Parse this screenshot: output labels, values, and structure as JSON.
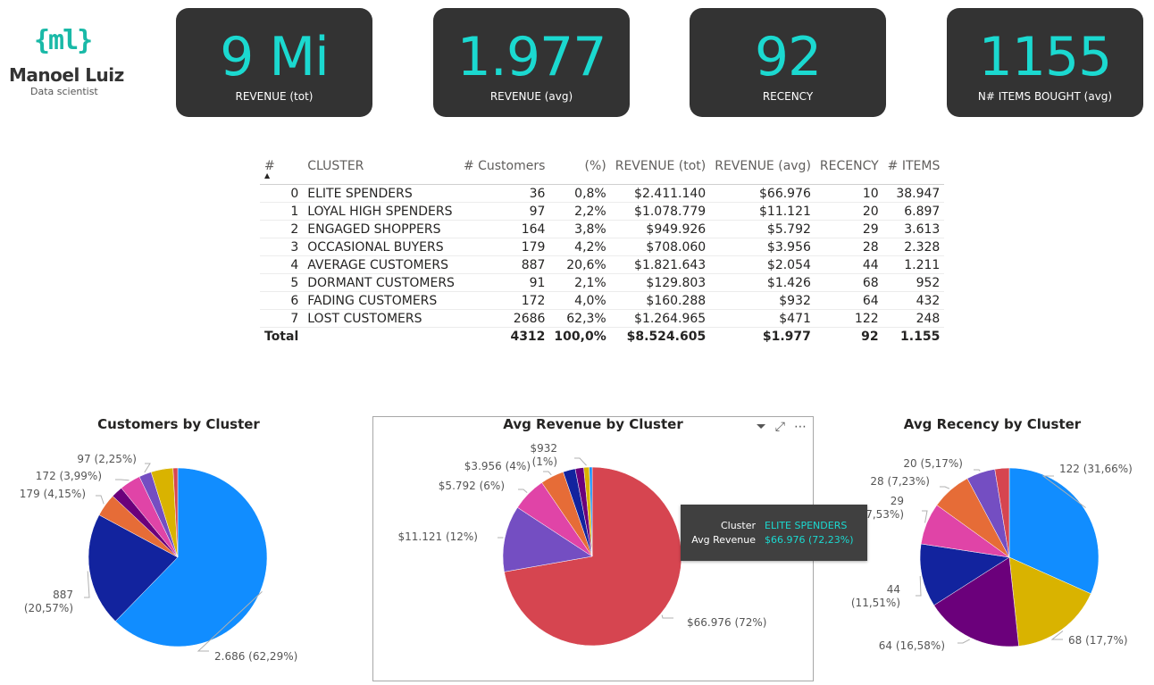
{
  "logo": {
    "mark": "{ml}",
    "name": "Manoel Luiz",
    "role": "Data scientist"
  },
  "kpis": [
    {
      "value": "9 Mi",
      "label": "REVENUE (tot)"
    },
    {
      "value": "1.977",
      "label": "REVENUE (avg)"
    },
    {
      "value": "92",
      "label": "RECENCY"
    },
    {
      "value": "1155",
      "label": "N# ITEMS BOUGHT (avg)"
    }
  ],
  "table": {
    "headers": [
      "#",
      "CLUSTER",
      "# Customers",
      "(%)",
      "REVENUE (tot)",
      "REVENUE (avg)",
      "RECENCY",
      "# ITEMS"
    ],
    "rows": [
      [
        "0",
        "ELITE SPENDERS",
        "36",
        "0,8%",
        "$2.411.140",
        "$66.976",
        "10",
        "38.947"
      ],
      [
        "1",
        "LOYAL HIGH SPENDERS",
        "97",
        "2,2%",
        "$1.078.779",
        "$11.121",
        "20",
        "6.897"
      ],
      [
        "2",
        "ENGAGED SHOPPERS",
        "164",
        "3,8%",
        "$949.926",
        "$5.792",
        "29",
        "3.613"
      ],
      [
        "3",
        "OCCASIONAL BUYERS",
        "179",
        "4,2%",
        "$708.060",
        "$3.956",
        "28",
        "2.328"
      ],
      [
        "4",
        "AVERAGE CUSTOMERS",
        "887",
        "20,6%",
        "$1.821.643",
        "$2.054",
        "44",
        "1.211"
      ],
      [
        "5",
        "DORMANT CUSTOMERS",
        "91",
        "2,1%",
        "$129.803",
        "$1.426",
        "68",
        "952"
      ],
      [
        "6",
        "FADING CUSTOMERS",
        "172",
        "4,0%",
        "$160.288",
        "$932",
        "64",
        "432"
      ],
      [
        "7",
        "LOST CUSTOMERS",
        "2686",
        "62,3%",
        "$1.264.965",
        "$471",
        "122",
        "248"
      ]
    ],
    "total": [
      "Total",
      "",
      "4312",
      "100,0%",
      "$8.524.605",
      "$1.977",
      "92",
      "1.155"
    ]
  },
  "colors": {
    "cluster_colors": [
      "#d64550",
      "#744ec2",
      "#e044a7",
      "#e66c37",
      "#12239e",
      "#6b007b",
      "#d9b300",
      "#118dff"
    ],
    "kpi_value": "#1bd9d0",
    "card_bg": "#333333"
  },
  "icons": {
    "filter": "filter-icon",
    "focus": "focus-mode-icon",
    "more": "more-options-icon",
    "sort": "sort-ascending-icon"
  },
  "tooltip": {
    "k1": "Cluster",
    "v1": "ELITE SPENDERS",
    "k2": "Avg Revenue",
    "v2": "$66.976 (72,23%)"
  },
  "chart_data": [
    {
      "type": "pie",
      "title": "Customers by Cluster",
      "categories": [
        "ELITE SPENDERS",
        "LOYAL HIGH SPENDERS",
        "ENGAGED SHOPPERS",
        "OCCASIONAL BUYERS",
        "AVERAGE CUSTOMERS",
        "DORMANT CUSTOMERS",
        "FADING CUSTOMERS",
        "LOST CUSTOMERS"
      ],
      "values": [
        36,
        97,
        164,
        179,
        887,
        91,
        172,
        2686
      ],
      "order": [
        7,
        4,
        3,
        5,
        2,
        1,
        6,
        0
      ],
      "data_labels": [
        {
          "index": 7,
          "text": "2.686 (62,29%)"
        },
        {
          "index": 4,
          "text": "887",
          "text2": "(20,57%)"
        },
        {
          "index": 3,
          "text": "179 (4,15%)"
        },
        {
          "index": 2,
          "text": "172 (3,99%)"
        },
        {
          "index": 1,
          "text": "97 (2,25%)"
        }
      ]
    },
    {
      "type": "pie",
      "title": "Avg Revenue by Cluster",
      "categories": [
        "ELITE SPENDERS",
        "LOYAL HIGH SPENDERS",
        "ENGAGED SHOPPERS",
        "OCCASIONAL BUYERS",
        "AVERAGE CUSTOMERS",
        "DORMANT CUSTOMERS",
        "FADING CUSTOMERS",
        "LOST CUSTOMERS"
      ],
      "values": [
        66976,
        11121,
        5792,
        3956,
        2054,
        1426,
        932,
        471
      ],
      "order": [
        0,
        1,
        2,
        3,
        4,
        5,
        6,
        7
      ],
      "data_labels": [
        {
          "index": 0,
          "text": "$66.976 (72%)"
        },
        {
          "index": 1,
          "text": "$11.121 (12%)"
        },
        {
          "index": 2,
          "text": "$5.792 (6%)"
        },
        {
          "index": 3,
          "text": "$3.956 (4%)"
        },
        {
          "index": 6,
          "text": "$932",
          "text2": "(1%)"
        }
      ]
    },
    {
      "type": "pie",
      "title": "Avg Recency by Cluster",
      "categories": [
        "ELITE SPENDERS",
        "LOYAL HIGH SPENDERS",
        "ENGAGED SHOPPERS",
        "OCCASIONAL BUYERS",
        "AVERAGE CUSTOMERS",
        "DORMANT CUSTOMERS",
        "FADING CUSTOMERS",
        "LOST CUSTOMERS"
      ],
      "values": [
        10,
        20,
        29,
        28,
        44,
        68,
        64,
        122
      ],
      "order": [
        7,
        6,
        5,
        4,
        2,
        3,
        1,
        0
      ],
      "data_labels": [
        {
          "index": 7,
          "text": "122 (31,66%)"
        },
        {
          "index": 6,
          "text": "68 (17,7%)"
        },
        {
          "index": 5,
          "text": "64 (16,58%)"
        },
        {
          "index": 4,
          "text": "44",
          "text2": "(11,51%)"
        },
        {
          "index": 2,
          "text": "29",
          "text2": "(7,53%)"
        },
        {
          "index": 3,
          "text": "28 (7,23%)"
        },
        {
          "index": 1,
          "text": "20 (5,17%)"
        }
      ]
    }
  ]
}
